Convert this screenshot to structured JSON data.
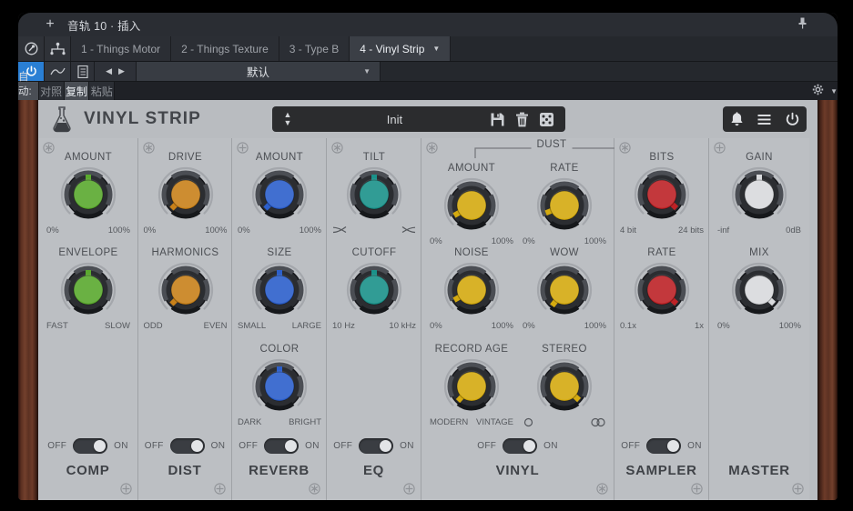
{
  "host": {
    "titlebar": {
      "add_label": "+",
      "title": "音轨 10 · 插入",
      "pin_icon": "pin-icon"
    },
    "tabs": [
      {
        "label": "1 - Things Motor",
        "active": false
      },
      {
        "label": "2 - Things Texture",
        "active": false
      },
      {
        "label": "3 - Type B",
        "active": false
      },
      {
        "label": "4 - Vinyl Strip",
        "active": true
      }
    ],
    "tab_caret": "▼",
    "tools": [
      "bypass-icon",
      "routing-icon"
    ],
    "automation_bar": {
      "power_icon": "power-icon",
      "curve_icon": "automation-curve-icon",
      "doc_icon": "preset-list-icon",
      "prev": "◀",
      "next": "▶",
      "preset_name": "默认",
      "caret": "▼"
    },
    "automation_bar2": {
      "auto_label": "自动: 关",
      "compare_label": "对照",
      "copy_label": "复制",
      "paste_label": "粘贴",
      "gear_icon": "gear-icon",
      "gear_caret": "▼"
    }
  },
  "plugin": {
    "logo_icon": "flask-logo-icon",
    "title": "VINYL STRIP",
    "preset": {
      "up_icon": "▲",
      "down_icon": "▼",
      "name": "Init",
      "save_icon": "save-icon",
      "delete_icon": "trash-icon",
      "random_icon": "dice-icon"
    },
    "header_right": {
      "notify_icon": "bell-icon",
      "menu_icon": "hamburger-menu-icon",
      "power_icon": "power-icon"
    },
    "sections": [
      {
        "name": "COMP",
        "color": "#5aa92e",
        "corner_icon": "asterisk-circle-icon",
        "corner_icon_br": "plus-circle-icon",
        "toggle": {
          "off": "OFF",
          "on": "ON",
          "state": "on"
        },
        "knobs": [
          {
            "label": "AMOUNT",
            "lo": "0%",
            "hi": "100%",
            "angle": 0
          },
          {
            "label": "ENVELOPE",
            "lo": "FAST",
            "hi": "SLOW",
            "angle": 0
          }
        ]
      },
      {
        "name": "DIST",
        "color": "#c8811a",
        "corner_icon": "asterisk-circle-icon",
        "corner_icon_br": "plus-circle-icon",
        "toggle": {
          "off": "OFF",
          "on": "ON",
          "state": "on"
        },
        "knobs": [
          {
            "label": "DRIVE",
            "lo": "0%",
            "hi": "100%",
            "angle": -135
          },
          {
            "label": "HARMONICS",
            "lo": "ODD",
            "hi": "EVEN",
            "angle": -135
          }
        ]
      },
      {
        "name": "REVERB",
        "color": "#2c5fcb",
        "corner_icon": "plus-circle-icon",
        "corner_icon_br": "asterisk-circle-icon",
        "toggle": {
          "off": "OFF",
          "on": "ON",
          "state": "on"
        },
        "knobs": [
          {
            "label": "AMOUNT",
            "lo": "0%",
            "hi": "100%",
            "angle": -135
          },
          {
            "label": "SIZE",
            "lo": "SMALL",
            "hi": "LARGE",
            "angle": 0
          },
          {
            "label": "COLOR",
            "lo": "DARK",
            "hi": "BRIGHT",
            "angle": 0
          }
        ]
      },
      {
        "name": "EQ",
        "color": "#1a9189",
        "corner_icon": "asterisk-circle-icon",
        "corner_icon_br": "plus-circle-icon",
        "toggle": {
          "off": "OFF",
          "on": "ON",
          "state": "on"
        },
        "knobs": [
          {
            "label": "TILT",
            "lo": "tilt-down-icon",
            "hi": "tilt-up-icon",
            "angle": 0,
            "glyph_range": true
          },
          {
            "label": "CUTOFF",
            "lo": "10 Hz",
            "hi": "10 kHz",
            "angle": 0
          }
        ]
      },
      {
        "name": "VINYL",
        "color": "#d4aa10",
        "corner_icon": "asterisk-circle-icon",
        "corner_icon_br": "asterisk-circle-icon",
        "group_label": "DUST",
        "toggle": {
          "off": "OFF",
          "on": "ON",
          "state": "on"
        },
        "knobs": [
          {
            "label": "AMOUNT",
            "lo": "0%",
            "hi": "100%",
            "angle": -120
          },
          {
            "label": "RATE",
            "lo": "0%",
            "hi": "100%",
            "angle": -112
          },
          {
            "label": "NOISE",
            "lo": "0%",
            "hi": "100%",
            "angle": -120
          },
          {
            "label": "WOW",
            "lo": "0%",
            "hi": "100%",
            "angle": -142
          },
          {
            "label": "RECORD AGE",
            "lo": "MODERN",
            "hi": "VINTAGE",
            "angle": -137
          },
          {
            "label": "STEREO",
            "lo": "mono-icon",
            "hi": "stereo-icon",
            "angle": 133,
            "glyph_range": true
          }
        ]
      },
      {
        "name": "SAMPLER",
        "color": "#bd2226",
        "corner_icon": "asterisk-circle-icon",
        "corner_icon_br": "plus-circle-icon",
        "toggle": {
          "off": "OFF",
          "on": "ON",
          "state": "on"
        },
        "knobs": [
          {
            "label": "BITS",
            "lo": "4 bit",
            "hi": "24 bits",
            "angle": 133
          },
          {
            "label": "RATE",
            "lo": "0.1x",
            "hi": "1x",
            "angle": 133
          }
        ]
      },
      {
        "name": "MASTER",
        "color": "#d8dadd",
        "corner_icon": "plus-circle-icon",
        "corner_icon_br": "plus-circle-icon",
        "toggle": null,
        "knobs": [
          {
            "label": "GAIN",
            "lo": "-inf",
            "hi": "0dB",
            "angle": 0
          },
          {
            "label": "MIX",
            "lo": "0%",
            "hi": "100%",
            "angle": 133
          }
        ]
      }
    ]
  }
}
